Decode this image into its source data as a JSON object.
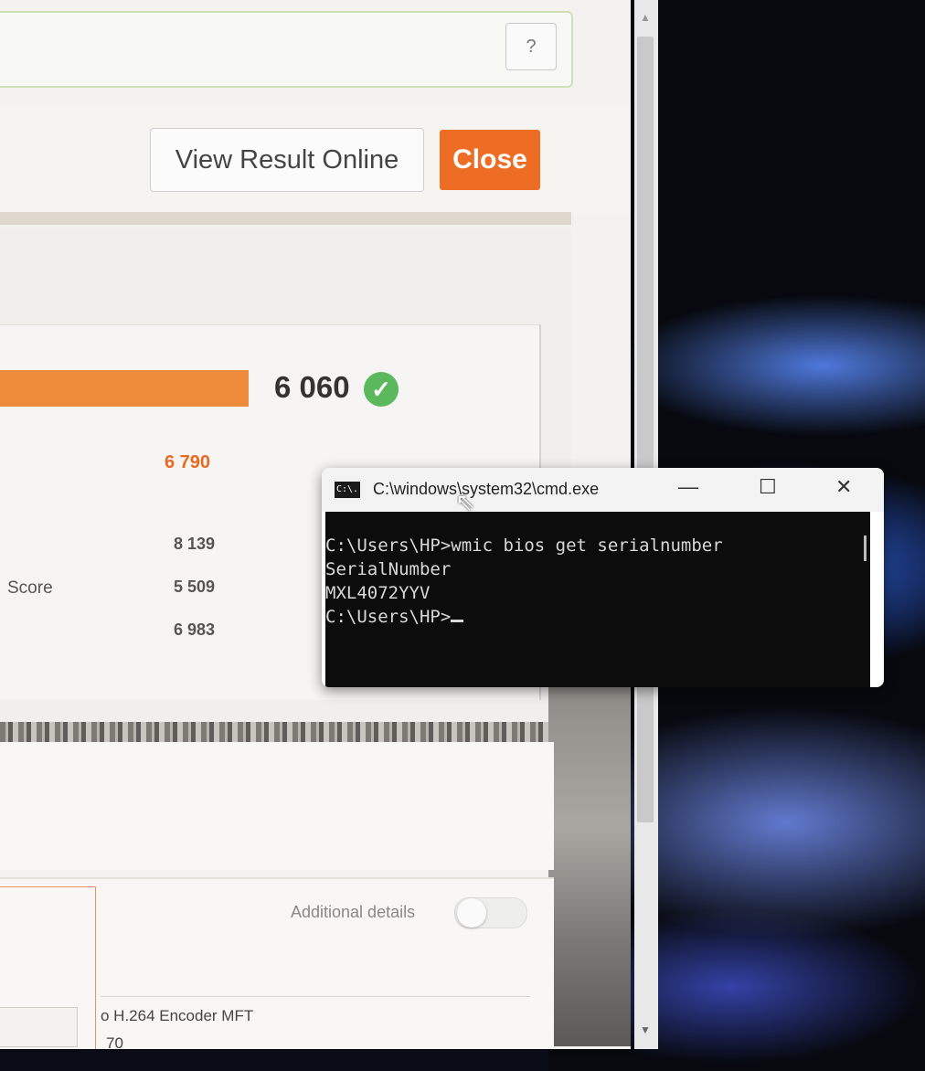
{
  "app": {
    "help_label": "?",
    "view_online_label": "View Result Online",
    "close_label": "Close",
    "main_score": "6 060",
    "sub_score": "6 790",
    "rows": [
      {
        "label": "",
        "value": "8 139"
      },
      {
        "label": "Score",
        "value": "5 509"
      },
      {
        "label": "",
        "value": "6 983"
      }
    ],
    "additional_details_label": "Additional details",
    "encoder_text": "o H.264 Encoder MFT",
    "encoder_num": "70"
  },
  "cmd": {
    "title": "C:\\windows\\system32\\cmd.exe",
    "icon_text": "C:\\.",
    "minimize_glyph": "—",
    "maximize_glyph": "☐",
    "close_glyph": "✕",
    "lines": [
      "C:\\Users\\HP>wmic bios get serialnumber",
      "SerialNumber",
      "MXL4072YYV",
      "",
      "C:\\Users\\HP>"
    ]
  },
  "colors": {
    "accent_orange": "#ee6d25",
    "success_green": "#5cb85c",
    "cmd_background": "#0c0c0c"
  }
}
